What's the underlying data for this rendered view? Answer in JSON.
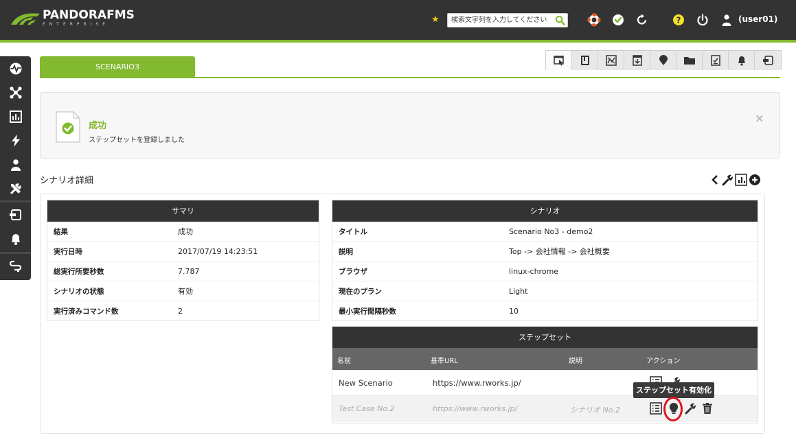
{
  "header": {
    "logo_title": "PANDORAFMS",
    "logo_subtitle": "ENTERPRISE",
    "search_placeholder": "検索文字列を入力してください",
    "user": "(user01)"
  },
  "sidebar": {
    "items": [
      "monitoring-icon",
      "topology-icon",
      "reports-icon",
      "events-icon",
      "workspace-icon",
      "tools-icon",
      "setup-icon",
      "alerts-icon",
      "links-icon"
    ]
  },
  "tabs": {
    "active_label": "SCENARIO3"
  },
  "toolbar": {
    "items": [
      "operation-icon",
      "book-icon",
      "chart-icon",
      "archive-icon",
      "location-icon",
      "folder-icon",
      "checklist-icon",
      "bell-icon",
      "module-icon"
    ]
  },
  "notice": {
    "title": "成功",
    "message": "ステップセットを登録しました",
    "close": "×"
  },
  "section": {
    "title": "シナリオ詳細"
  },
  "summary": {
    "header": "サマリ",
    "rows": [
      {
        "key": "結果",
        "value": "成功"
      },
      {
        "key": "実行日時",
        "value": "2017/07/19 14:23:51"
      },
      {
        "key": "総実行所要秒数",
        "value": "7.787"
      },
      {
        "key": "シナリオの状態",
        "value": "有効"
      },
      {
        "key": "実行済みコマンド数",
        "value": "2"
      }
    ]
  },
  "scenario": {
    "header": "シナリオ",
    "rows": [
      {
        "key": "タイトル",
        "value": "Scenario No3 - demo2"
      },
      {
        "key": "説明",
        "value": "Top -> 会社情報 -> 会社概要"
      },
      {
        "key": "ブラウザ",
        "value": "linux-chrome"
      },
      {
        "key": "現在のプラン",
        "value": "Light"
      },
      {
        "key": "最小実行間隔秒数",
        "value": "10"
      }
    ]
  },
  "stepset": {
    "header": "ステップセット",
    "columns": {
      "name": "名前",
      "url": "基準URL",
      "desc": "説明",
      "action": "アクション"
    },
    "rows": [
      {
        "name": "New Scenario",
        "url": "https://www.rworks.jp/",
        "desc": "",
        "enabled": true
      },
      {
        "name": "Test Case No.2",
        "url": "https://www.rworks.jp/",
        "desc": "シナリオ No.2",
        "enabled": false
      }
    ],
    "tooltip": "ステップセット有効化"
  },
  "colors": {
    "accent": "#82b92e",
    "header_bg": "#333333",
    "highlight": "#e0141e"
  }
}
